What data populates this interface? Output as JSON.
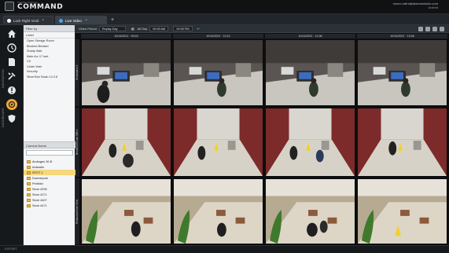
{
  "brand": {
    "small": "Toshiba Systems",
    "large": "COMMAND"
  },
  "account": {
    "email": "nnnnn.ndfrn@abcbcbcbcbc.com",
    "sub": "Ardtmit"
  },
  "tabs": [
    {
      "label": "Lock Right Vivid",
      "accent": "#ffffff"
    },
    {
      "label": "Live Video",
      "accent": "#3fa9f5"
    }
  ],
  "rail": {
    "labels": [
      "NAVIGATION",
      "DASHBOARD"
    ],
    "icons": [
      "home-icon",
      "clock-icon",
      "document-icon",
      "tools-icon",
      "alert-icon",
      "target-icon",
      "shield-icon"
    ]
  },
  "filters": {
    "header": "Filter by",
    "subheader": "Label",
    "items": [
      "Open Storage Room",
      "Blocked Breaker",
      "Shady Wait",
      "Male Arc 17 last.",
      "Ctl",
      "Under Wair",
      "Security",
      "SilverSimi Swab 12.0.8"
    ]
  },
  "cameras": {
    "header": "Camera Name",
    "items": [
      "Ambogen 36 B",
      "Ardwater",
      "SPOT 1",
      "Downeyook",
      "Prelbish",
      "Store 4298",
      "Store 4271",
      "Store 4407",
      "Store 4471"
    ],
    "selected_index": 2
  },
  "toolbar": {
    "video_period_label": "Video Period",
    "period_value": "Replay Day",
    "all_day_label": "All Day",
    "from_time": "09:00 AM",
    "to_time": "09:30 PM"
  },
  "grid": {
    "column_times": [
      "10/14/2021 · 09:43",
      "10/14/2021 · 10:12",
      "10/14/2021 · 11:08",
      "10/14/2021 · 13:48"
    ],
    "row_labels": [
      "Workstation 2",
      "Breakroom Cam Office",
      "Restaurant Over View"
    ]
  },
  "status": {
    "text": "EXPORT"
  },
  "colors": {
    "accent": "#f2a93b",
    "selected": "#f6d77a"
  }
}
